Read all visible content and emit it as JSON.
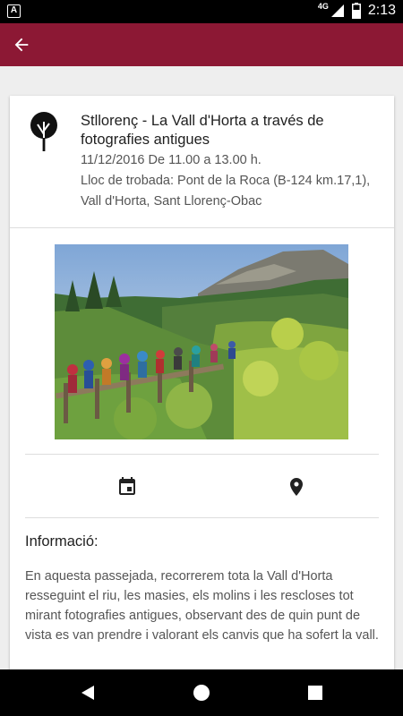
{
  "status_bar": {
    "app_icon_letter": "A",
    "network": "4G",
    "time": "2:13"
  },
  "app_bar": {
    "color": "#8c1834",
    "back_icon": "arrow-back-icon"
  },
  "event": {
    "title": "Stllorenç - La Vall d'Horta a través de fotografies antigues",
    "date": "11/12/2016 De 11.00 a 13.00 h.",
    "meeting_point": "Lloc de trobada: Pont de la Roca (B-124 km.17,1), Vall d'Horta, Sant Llorenç-Obac",
    "logo_icon": "tree-icon",
    "photo_icon": "hikers-photo"
  },
  "actions": {
    "calendar_icon": "calendar-icon",
    "location_icon": "location-pin-icon"
  },
  "info": {
    "heading": "Informació:",
    "text": "En aquesta passejada, recorrerem tota la Vall d'Horta resseguint el riu, les masies, els molins i les rescloses tot mirant fotografies antigues, observant des de quin punt de vista es van prendre i valorant els canvis que ha sofert la vall."
  },
  "nav_bar": {
    "back_icon": "triangle-back-icon",
    "home_icon": "circle-home-icon",
    "recents_icon": "square-recents-icon"
  }
}
